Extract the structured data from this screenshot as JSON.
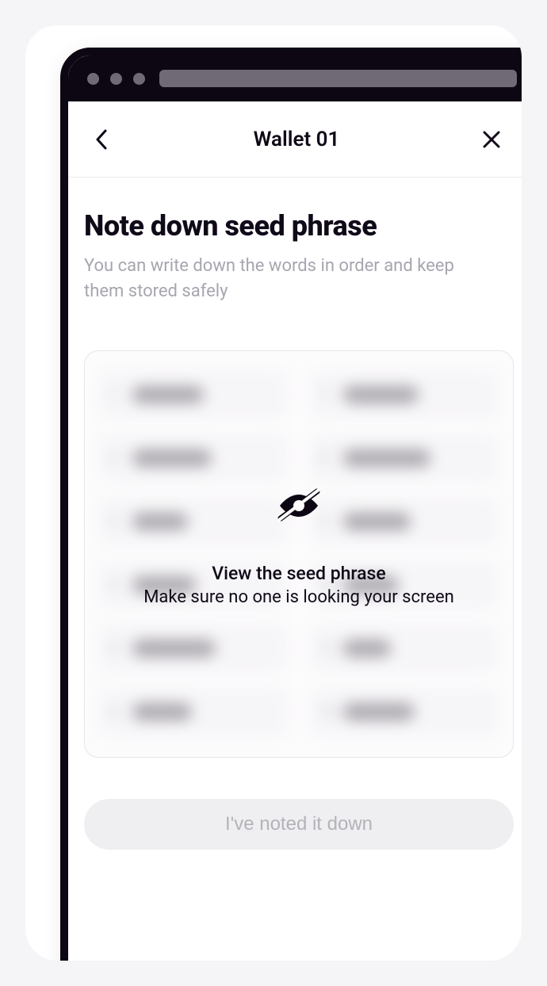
{
  "header": {
    "title": "Wallet 01"
  },
  "page": {
    "heading": "Note down seed phrase",
    "subheading": "You can write down the words in order and keep them stored safely"
  },
  "reveal": {
    "title": "View the seed phrase",
    "subtitle": "Make sure no one is looking your screen"
  },
  "actions": {
    "primary_label": "I've noted it down"
  },
  "seed": {
    "word_count": 12,
    "hidden": true
  }
}
